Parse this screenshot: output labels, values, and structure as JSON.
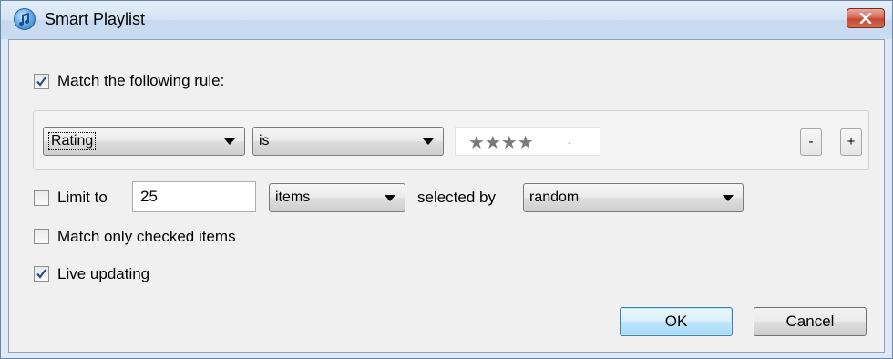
{
  "window": {
    "title": "Smart Playlist",
    "close_label": "x"
  },
  "match_rule": {
    "checked": true,
    "label": "Match the following rule:"
  },
  "rule": {
    "field": "Rating",
    "operator": "is",
    "rating_stars": 4,
    "rating_max": 5,
    "stars_text": "★★★★",
    "empty_star_text": "·",
    "remove_label": "-",
    "add_label": "+"
  },
  "limit": {
    "checked": false,
    "label": "Limit to",
    "value": "25",
    "unit": "items",
    "selected_by_label": "selected by",
    "selected_by": "random"
  },
  "match_checked": {
    "checked": false,
    "label": "Match only checked items"
  },
  "live_updating": {
    "checked": true,
    "label": "Live updating"
  },
  "buttons": {
    "ok": "OK",
    "cancel": "Cancel"
  }
}
